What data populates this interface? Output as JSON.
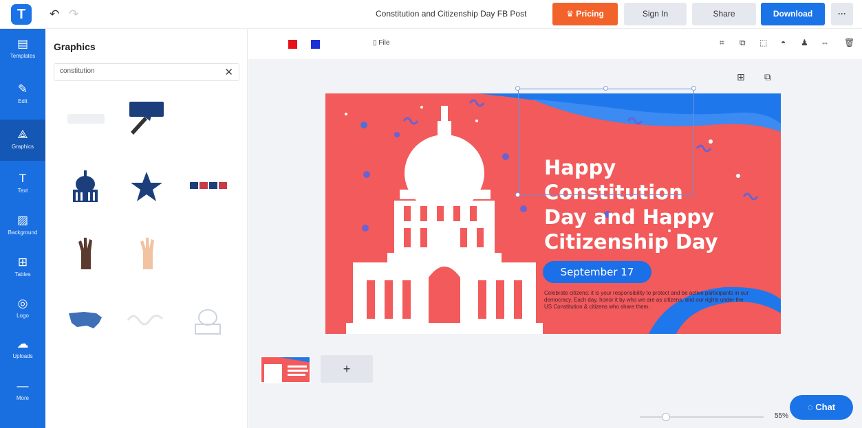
{
  "header": {
    "logo_letter": "T",
    "undo_icon": "↶",
    "redo_icon": "↷",
    "doc_title": "Constitution and Citizenship Day FB Post",
    "pricing_label": "Pricing",
    "pricing_icon": "♛",
    "signin_label": "Sign In",
    "share_label": "Share",
    "download_label": "Download",
    "more_label": "···"
  },
  "sidebar": {
    "items": [
      {
        "label": "Templates",
        "icon": "▤"
      },
      {
        "label": "Edit",
        "icon": "✎"
      },
      {
        "label": "Graphics",
        "icon": "⟁"
      },
      {
        "label": "Text",
        "icon": "T"
      },
      {
        "label": "Background",
        "icon": "▨"
      },
      {
        "label": "Tables",
        "icon": "⊞"
      },
      {
        "label": "Logo",
        "icon": "◎"
      },
      {
        "label": "Uploads",
        "icon": "☁"
      },
      {
        "label": "More",
        "icon": "—"
      }
    ]
  },
  "panel": {
    "title": "Graphics",
    "search_value": "constitution",
    "clear_icon": "✕"
  },
  "toolbar": {
    "colors": [
      "#e8101a",
      "#1a2fd6"
    ],
    "file_label": "File",
    "file_icon": "▯",
    "tool_icons": [
      "⌗",
      "⧉",
      "⬚",
      "◓",
      "♟",
      "⇔",
      "🗑"
    ]
  },
  "design": {
    "headline_lines": [
      "Happy",
      "Constitution",
      "Day and Happy",
      "Citizenship Day"
    ],
    "date_label": "September 17",
    "body_text": "Celebrate citizens: it is your responsibility to protect and be active participants in our democracy. Each day, honor it by who we are as citizens, and our rights under the US Constitution & citizens who share them."
  },
  "bottom": {
    "add_page_icon": "+",
    "zoom_value": "55%",
    "chat_label": "Chat",
    "chat_icon": "◌"
  }
}
